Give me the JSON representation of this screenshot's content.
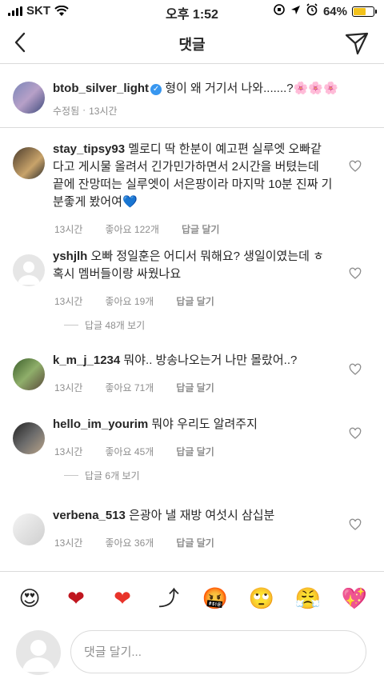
{
  "status_bar": {
    "carrier": "SKT",
    "time": "오후 1:52",
    "battery": "64%",
    "battery_level": 0.64
  },
  "header": {
    "title": "댓글"
  },
  "caption": {
    "username": "btob_silver_light",
    "text": "형이 왜 거기서 나와.......?🌸🌸🌸",
    "edited": "수정됨",
    "time": "13시간"
  },
  "comments": [
    {
      "username": "stay_tipsy93",
      "lines": [
        "멜로디 딱 한분이 예고편 실루엣 오빠같",
        "다고 게시물 올려서 긴가민가하면서 2시간을 버텼는데",
        "끝에 잔망떠는 실루엣이 서은팡이라 마지막 10분 진짜 기",
        "분좋게 봤어여💙"
      ],
      "time": "13시간",
      "likes": "좋아요 122개",
      "reply": "답글 달기"
    },
    {
      "username": "yshjlh",
      "lines": [
        "오빠 정일훈은 어디서 뭐해요? 생일이였는데 ㅎ",
        "혹시 멤버들이랑 싸웠나요"
      ],
      "time": "13시간",
      "likes": "좋아요 19개",
      "reply": "답글 달기",
      "view_replies": "답글 48개 보기"
    },
    {
      "username": "k_m_j_1234",
      "lines": [
        "뭐야.. 방송나오는거 나만 몰랐어..?"
      ],
      "time": "13시간",
      "likes": "좋아요 71개",
      "reply": "답글 달기"
    },
    {
      "username": "hello_im_yourim",
      "lines": [
        "뭐야 우리도 알려주지"
      ],
      "time": "13시간",
      "likes": "좋아요 45개",
      "reply": "답글 달기",
      "view_replies": "답글 6개 보기"
    },
    {
      "username": "verbena_513",
      "lines": [
        "은광아 낼 재방 여섯시 삼십분"
      ],
      "time": "13시간",
      "likes": "좋아요 36개",
      "reply": "답글 달기"
    }
  ],
  "emoji_bar": [
    "😍",
    "❤",
    "❤",
    "⤴",
    "🤬",
    "🙄",
    "😤",
    "💖"
  ],
  "input": {
    "placeholder": "댓글 달기..."
  },
  "colors": {
    "verified": "#3897f0",
    "battery": "#f2c21b",
    "meta": "#8e8e8e"
  }
}
